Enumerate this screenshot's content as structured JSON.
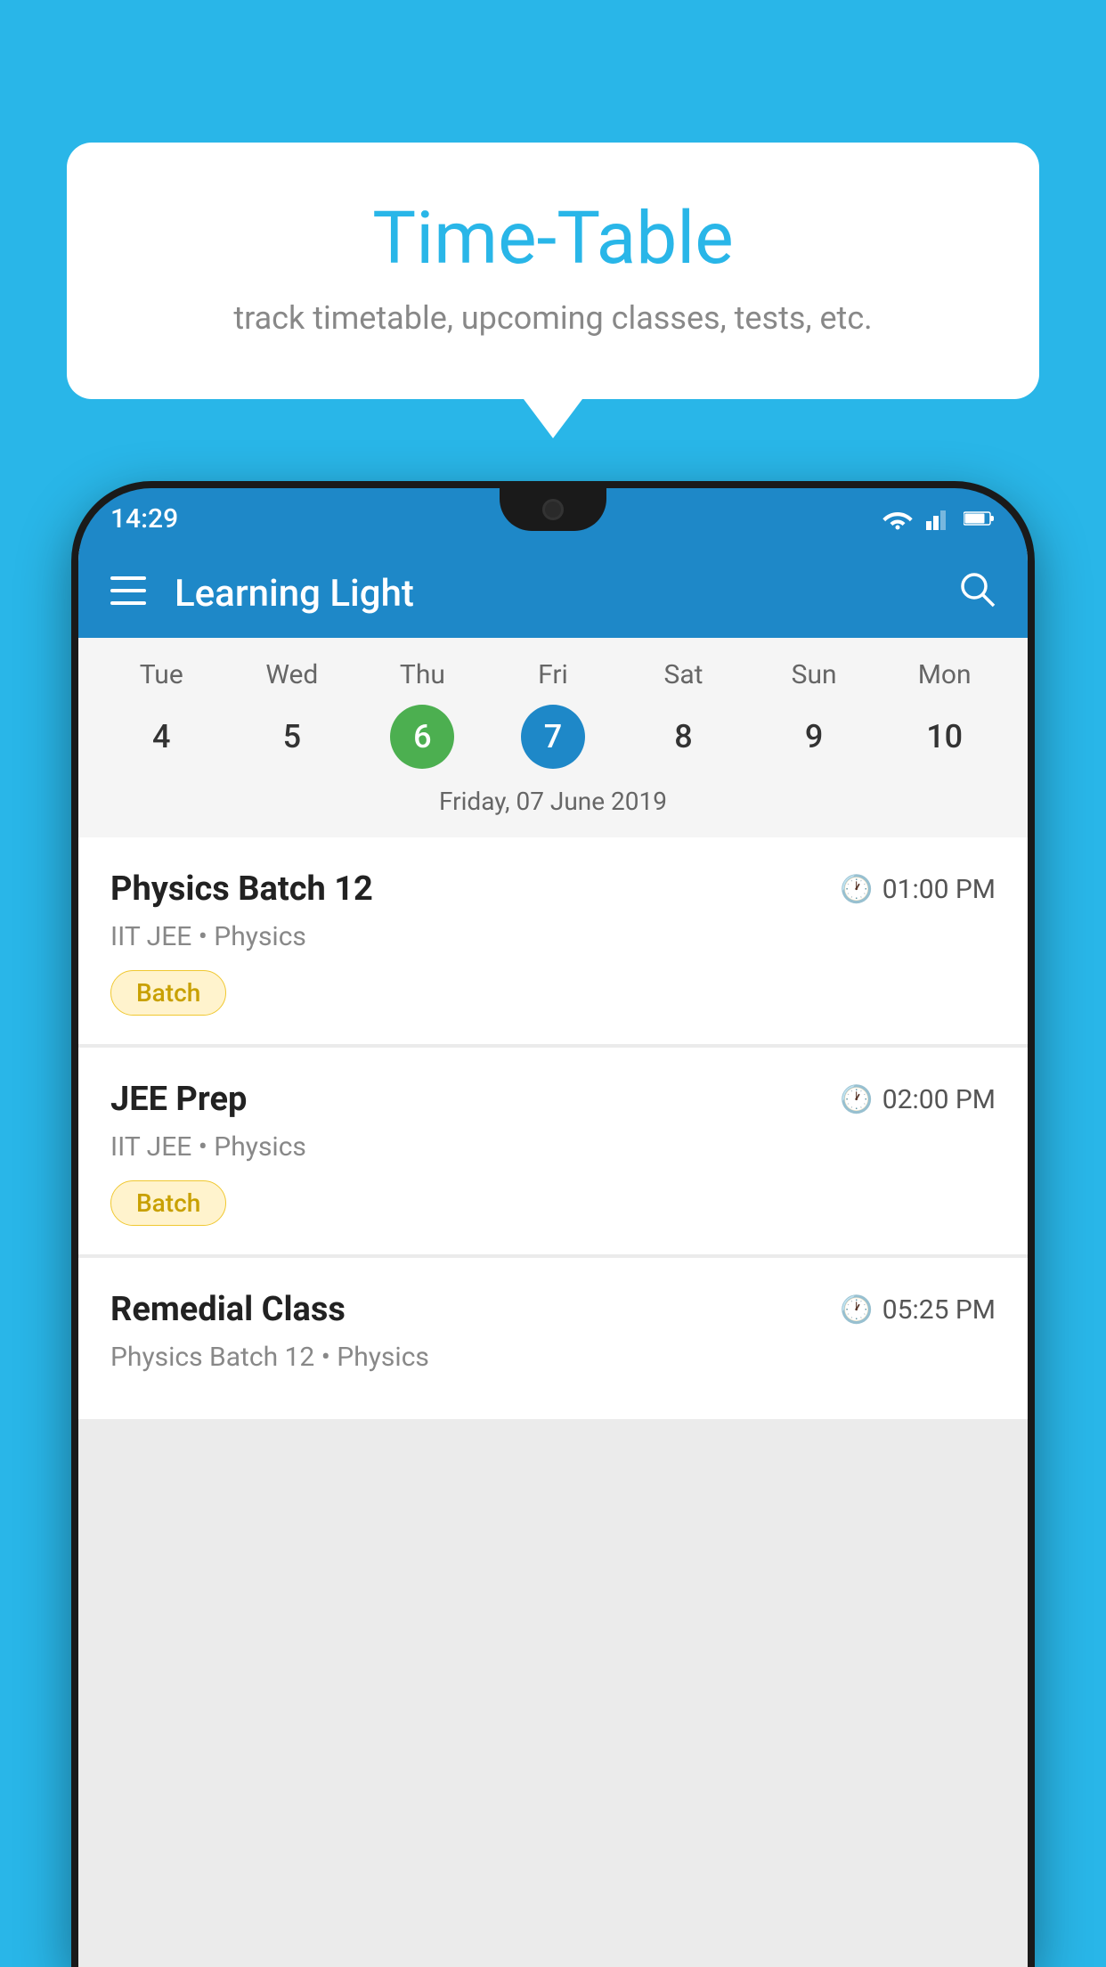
{
  "background_color": "#29b6e8",
  "tooltip": {
    "title": "Time-Table",
    "subtitle": "track timetable, upcoming classes, tests, etc."
  },
  "phone": {
    "status_bar": {
      "time": "14:29"
    },
    "app_bar": {
      "title": "Learning Light"
    },
    "calendar": {
      "days": [
        {
          "day": "Tue",
          "num": "4",
          "state": "normal"
        },
        {
          "day": "Wed",
          "num": "5",
          "state": "normal"
        },
        {
          "day": "Thu",
          "num": "6",
          "state": "today"
        },
        {
          "day": "Fri",
          "num": "7",
          "state": "selected"
        },
        {
          "day": "Sat",
          "num": "8",
          "state": "normal"
        },
        {
          "day": "Sun",
          "num": "9",
          "state": "normal"
        },
        {
          "day": "Mon",
          "num": "10",
          "state": "normal"
        }
      ],
      "selected_date_label": "Friday, 07 June 2019"
    },
    "classes": [
      {
        "name": "Physics Batch 12",
        "time": "01:00 PM",
        "subject": "IIT JEE • Physics",
        "badge": "Batch"
      },
      {
        "name": "JEE Prep",
        "time": "02:00 PM",
        "subject": "IIT JEE • Physics",
        "badge": "Batch"
      },
      {
        "name": "Remedial Class",
        "time": "05:25 PM",
        "subject": "Physics Batch 12 • Physics",
        "badge": null
      }
    ]
  }
}
